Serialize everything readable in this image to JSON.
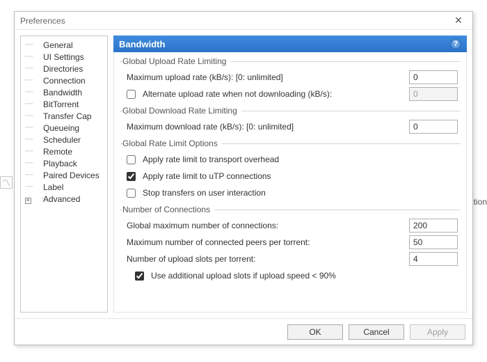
{
  "background": {
    "left_button_glyph": "〽",
    "right_fragment": "ition"
  },
  "dialog": {
    "title": "Preferences",
    "close_glyph": "✕"
  },
  "nav": {
    "items": [
      "General",
      "UI Settings",
      "Directories",
      "Connection",
      "Bandwidth",
      "BitTorrent",
      "Transfer Cap",
      "Queueing",
      "Scheduler",
      "Remote",
      "Playback",
      "Paired Devices",
      "Label"
    ],
    "advanced_label": "Advanced",
    "advanced_expander": "+"
  },
  "header": {
    "title": "Bandwidth",
    "help_glyph": "?"
  },
  "groups": {
    "upload": {
      "legend": "Global Upload Rate Limiting",
      "max_label": "Maximum upload rate (kB/s): [0: unlimited]",
      "max_value": "0",
      "alt_label": "Alternate upload rate when not downloading (kB/s):",
      "alt_checked": false,
      "alt_value": "0"
    },
    "download": {
      "legend": "Global Download Rate Limiting",
      "max_label": "Maximum download rate (kB/s): [0: unlimited]",
      "max_value": "0"
    },
    "options": {
      "legend": "Global Rate Limit Options",
      "overhead_label": "Apply rate limit to transport overhead",
      "overhead_checked": false,
      "utp_label": "Apply rate limit to uTP connections",
      "utp_checked": true,
      "stop_label": "Stop transfers on user interaction",
      "stop_checked": false
    },
    "connections": {
      "legend": "Number of Connections",
      "global_label": "Global maximum number of connections:",
      "global_value": "200",
      "peers_label": "Maximum number of connected peers per torrent:",
      "peers_value": "50",
      "slots_label": "Number of upload slots per torrent:",
      "slots_value": "4",
      "extra_label": "Use additional upload slots if upload speed < 90%",
      "extra_checked": true
    }
  },
  "footer": {
    "ok": "OK",
    "cancel": "Cancel",
    "apply": "Apply"
  }
}
